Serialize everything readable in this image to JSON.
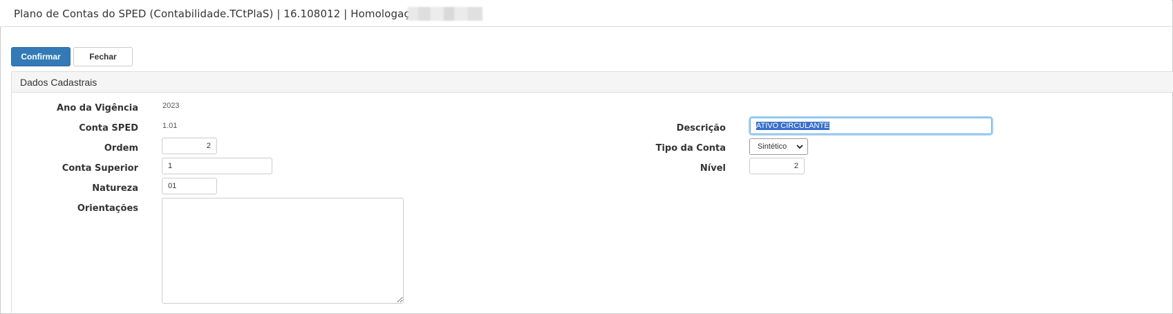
{
  "window": {
    "title": "Plano de Contas do SPED (Contabilidade.TCtPlaS) | 16.108012 | Homologação |"
  },
  "toolbar": {
    "confirm_label": "Confirmar",
    "close_label": "Fechar"
  },
  "panel": {
    "heading": "Dados Cadastrais"
  },
  "form": {
    "ano_vigencia": {
      "label": "Ano da Vigência",
      "value": "2023"
    },
    "conta_sped": {
      "label": "Conta SPED",
      "value": "1.01"
    },
    "ordem": {
      "label": "Ordem",
      "value": "2"
    },
    "conta_superior": {
      "label": "Conta Superior",
      "value": "1"
    },
    "natureza": {
      "label": "Natureza",
      "value": "01"
    },
    "orientacoes": {
      "label": "Orientações",
      "value": ""
    },
    "descricao": {
      "label": "Descrição",
      "value": "ATIVO CIRCULANTE"
    },
    "tipo_conta": {
      "label": "Tipo da Conta",
      "selected": "Sintético"
    },
    "nivel": {
      "label": "Nível",
      "value": "2"
    }
  },
  "icons": {
    "select_arrow": "chevron-down-icon",
    "resize_handle": "resize-grip-icon"
  },
  "colors": {
    "primary_button": "#337ab7",
    "focus_ring": "#66afe9",
    "selection": "#3a70c9"
  }
}
